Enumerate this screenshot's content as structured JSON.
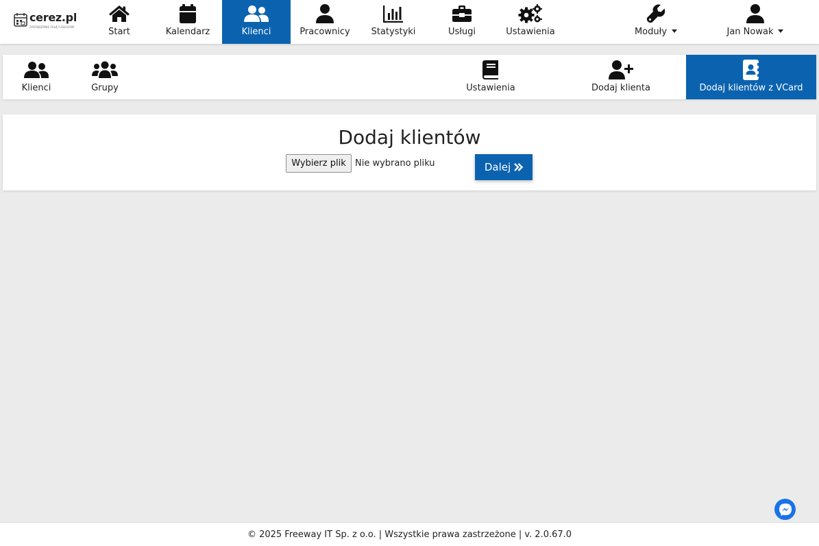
{
  "brand": {
    "name": "cerez.pl",
    "tagline": "ZARZĄDZANIE SALĄ I USŁUGAMI"
  },
  "topnav": {
    "items": [
      {
        "label": "Start",
        "icon": "home-icon"
      },
      {
        "label": "Kalendarz",
        "icon": "calendar-icon"
      },
      {
        "label": "Klienci",
        "icon": "users-icon",
        "active": true
      },
      {
        "label": "Pracownicy",
        "icon": "user-icon"
      },
      {
        "label": "Statystyki",
        "icon": "chart-icon"
      },
      {
        "label": "Usługi",
        "icon": "toolbox-icon"
      },
      {
        "label": "Ustawienia",
        "icon": "gears-icon"
      }
    ],
    "modules_label": "Moduły",
    "user_label": "Jan Nowak"
  },
  "subnav": {
    "items": [
      {
        "label": "Klienci",
        "icon": "users-icon"
      },
      {
        "label": "Grupy",
        "icon": "user-group-icon"
      },
      {
        "label": "Ustawienia",
        "icon": "book-icon"
      },
      {
        "label": "Dodaj klienta",
        "icon": "user-plus-icon"
      },
      {
        "label": "Dodaj klientów z VCard",
        "icon": "address-book-icon",
        "active": true
      }
    ]
  },
  "main": {
    "title": "Dodaj klientów",
    "file_button_label": "Wybierz plik",
    "file_status": "Nie wybrano pliku",
    "next_button_label": "Dalej"
  },
  "footer": {
    "text": "© 2025 Freeway IT Sp. z o.o. | Wszystkie prawa zastrzeżone | v. 2.0.67.0"
  },
  "colors": {
    "primary": "#0b63b0",
    "background": "#ebebeb",
    "messenger": "#1a73e8"
  }
}
